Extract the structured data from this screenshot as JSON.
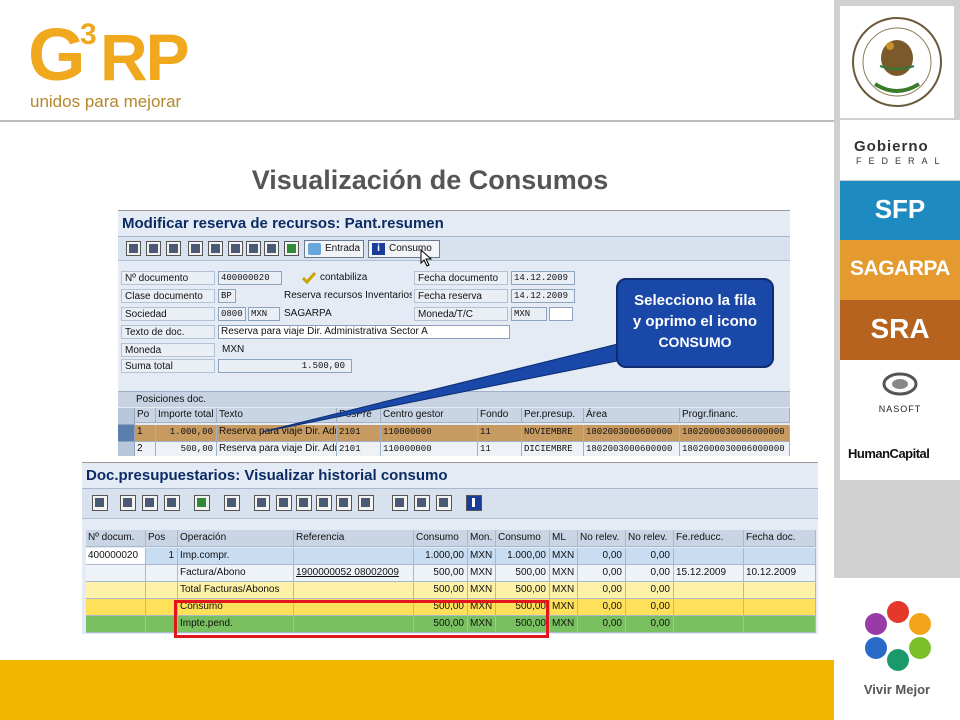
{
  "brand": {
    "logo_letters": "G3RP",
    "logo_g": "G",
    "logo_3": "3",
    "logo_rp": "RP",
    "tagline": "unidos para mejorar"
  },
  "slide_title": "Visualización de Consumos",
  "sidebar": {
    "gobierno_line1": "Gobierno",
    "gobierno_line2": "FEDERAL",
    "sfp": "SFP",
    "sagarpa": "SAGARPA",
    "sra": "SRA",
    "nasoft": "NASOFT",
    "humancapital": "HumanCapital",
    "vivir_mejor": "Vivir Mejor"
  },
  "sap_reserva": {
    "title": "Modificar reserva de recursos: Pant.resumen",
    "toolbar": {
      "entrada_label": "Entrada",
      "consumo_label": "Consumo"
    },
    "fields": {
      "n_documento_label": "Nº documento",
      "n_documento_value": "400000020",
      "contabiliza": "contabiliza",
      "fecha_documento_label": "Fecha documento",
      "fecha_documento_value": "14.12.2009",
      "clase_documento_label": "Clase documento",
      "clase_documento_value": "BP",
      "clase_documento_text": "Reserva recursos Inventarios",
      "fecha_reserva_label": "Fecha reserva",
      "fecha_reserva_value": "14.12.2009",
      "sociedad_label": "Sociedad",
      "sociedad_value": "0800",
      "sociedad_currency": "MXN",
      "sociedad_name": "SAGARPA",
      "moneda_tc_label": "Moneda/T/C",
      "moneda_tc_value": "MXN",
      "texto_doc_label": "Texto de doc.",
      "texto_doc_value": "Reserva para viaje Dir. Administrativa Sector A",
      "moneda_label": "Moneda",
      "moneda_value": "MXN",
      "suma_total_label": "Suma total",
      "suma_total_value": "1.500,00"
    },
    "positions_title": "Posiciones doc.",
    "columns": [
      "Po",
      "Importe total",
      "Texto",
      "PosPre",
      "Centro gestor",
      "Fondo",
      "Per.presup.",
      "Área",
      "Progr.financ."
    ],
    "rows": [
      [
        "1",
        "1.000,00",
        "Reserva para viaje Dir. Adr",
        "2101",
        "110000000",
        "11",
        "NOVIEMBRE",
        "1802003000600000",
        "1802000030006000000"
      ],
      [
        "2",
        "500,00",
        "Reserva para viaje Dir. Adr",
        "2101",
        "110000000",
        "11",
        "DICIEMBRE",
        "1802003000600000",
        "1802000030006000000"
      ]
    ]
  },
  "sap_historial": {
    "title": "Doc.presupuestarios: Visualizar historial consumo",
    "columns": [
      "Nº docum.",
      "Pos",
      "Operación",
      "Referencia",
      "Consumo",
      "Mon.",
      "Consumo",
      "ML",
      "No relev.",
      "No relev.",
      "Fe.reducc.",
      "Fecha doc."
    ],
    "rows": [
      [
        "400000020",
        "1",
        "Imp.compr.",
        "",
        "1.000,00",
        "MXN",
        "1.000,00",
        "MXN",
        "0,00",
        "0,00",
        "",
        ""
      ],
      [
        "",
        "",
        "Factura/Abono",
        "1900000052 08002009",
        "500,00",
        "MXN",
        "500,00",
        "MXN",
        "0,00",
        "0,00",
        "15.12.2009",
        "10.12.2009"
      ],
      [
        "",
        "",
        "Total Facturas/Abonos",
        "",
        "500,00",
        "MXN",
        "500,00",
        "MXN",
        "0,00",
        "0,00",
        "",
        ""
      ],
      [
        "",
        "",
        "Consumo",
        "",
        "500,00",
        "MXN",
        "500,00",
        "MXN",
        "0,00",
        "0,00",
        "",
        ""
      ],
      [
        "",
        "",
        "Impte.pend.",
        "",
        "500,00",
        "MXN",
        "500,00",
        "MXN",
        "0,00",
        "0,00",
        "",
        ""
      ]
    ],
    "row_colors": [
      "#c8dcf2",
      "#eef3f9",
      "#fff2a8",
      "#ffe05a",
      "#78c060"
    ]
  },
  "callout": {
    "line1": "Selecciono la fila",
    "line2": "y oprimo el icono",
    "line3": "CONSUMO"
  },
  "colors": {
    "bottom_band": "#f3b600",
    "callout_bg": "#1a48a8",
    "highlight_box": "#e0161c",
    "sap_title": "#0b2b62"
  }
}
